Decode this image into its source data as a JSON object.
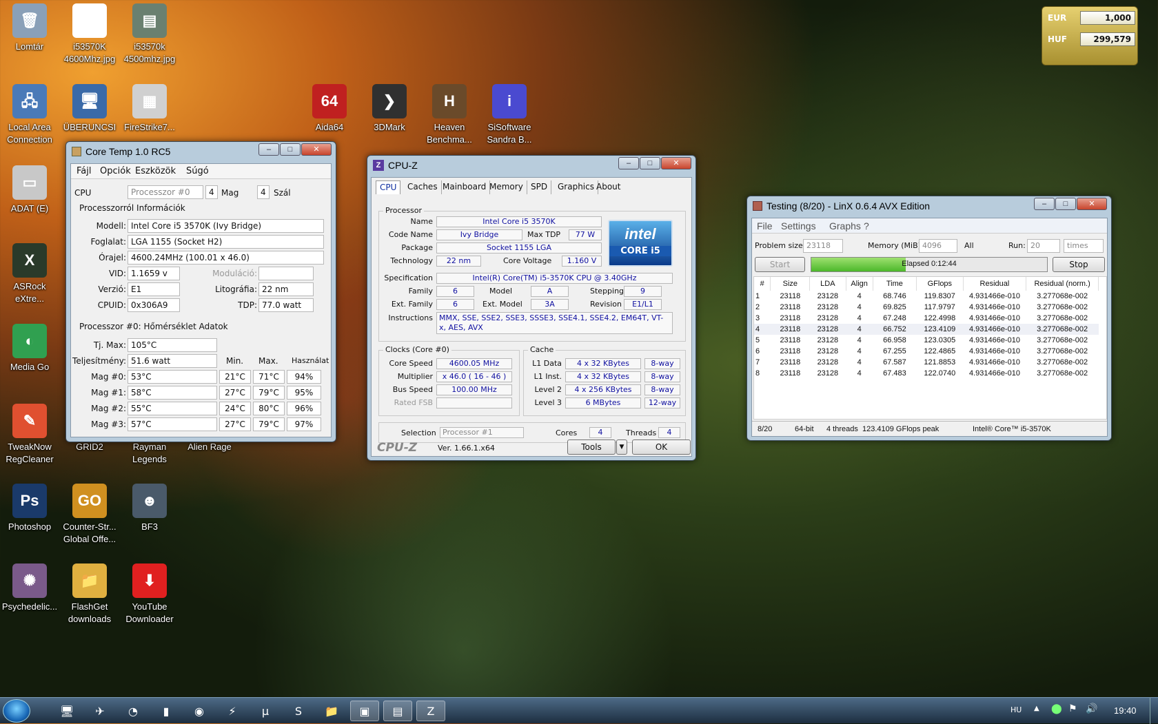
{
  "desktop": {
    "icons": [
      {
        "label": "Lomtár",
        "symbol": "🗑",
        "color": "#8aa0b8"
      },
      {
        "label": "i53570K 4600Mhz.jpg",
        "symbol": "▤",
        "color": "#ffffff"
      },
      {
        "label": "i53570k 4500mhz.jpg",
        "symbol": "▤",
        "color": "#6a8070"
      },
      {
        "label": "Local Area Connection",
        "symbol": "🖧",
        "color": "#4a7ab8"
      },
      {
        "label": "ÜBERUNCSI",
        "symbol": "🖥",
        "color": "#3a6aa8"
      },
      {
        "label": "FireStrike7...",
        "symbol": "▦",
        "color": "#d0d0d0"
      },
      {
        "label": "ADAT (E)",
        "symbol": "▭",
        "color": "#c8c8c8"
      },
      {
        "label": "ASRock eXtre...",
        "symbol": "X",
        "color": "#2a3a2a"
      },
      {
        "label": "Media Go",
        "symbol": "◐",
        "color": "#30a050"
      },
      {
        "label": "TweakNow RegCleaner",
        "symbol": "✎",
        "color": "#e05030"
      },
      {
        "label": "GRID2",
        "symbol": "",
        "color": "rgba(0,0,0,0)"
      },
      {
        "label": "Rayman Legends",
        "symbol": "",
        "color": "rgba(0,0,0,0)"
      },
      {
        "label": "Alien Rage",
        "symbol": "",
        "color": "rgba(0,0,0,0)"
      },
      {
        "label": "Photoshop",
        "symbol": "Ps",
        "color": "#1a3a6a"
      },
      {
        "label": "Counter-Str... Global Offe...",
        "symbol": "GO",
        "color": "#d09020"
      },
      {
        "label": "BF3",
        "symbol": "☻",
        "color": "#4a5a6a"
      },
      {
        "label": "Psychedelic...",
        "symbol": "✺",
        "color": "#7a5a8a"
      },
      {
        "label": "FlashGet downloads",
        "symbol": "📁",
        "color": "#e0b040"
      },
      {
        "label": "YouTube Downloader",
        "symbol": "⬇",
        "color": "#e02020"
      },
      {
        "label": "Aida64",
        "symbol": "64",
        "color": "#c02020"
      },
      {
        "label": "3DMark",
        "symbol": "❯",
        "color": "#303030"
      },
      {
        "label": "Heaven Benchma...",
        "symbol": "H",
        "color": "#6a4a2a"
      },
      {
        "label": "SiSoftware Sandra B...",
        "symbol": "i",
        "color": "#4a4ad0"
      }
    ]
  },
  "currency": {
    "eur_label": "EUR",
    "eur_value": "1,000",
    "huf_label": "HUF",
    "huf_value": "299,579"
  },
  "coretemp": {
    "title": "Core Temp 1.0 RC5",
    "menu": [
      "Fájl",
      "Opciók",
      "Eszközök",
      "Súgó"
    ],
    "cpu_label": "CPU",
    "processor_select": "Processzor #0",
    "cores": "4",
    "cores_label": "Mag",
    "threads": "4",
    "threads_label": "Szál",
    "info_title": "Processzorról Információk",
    "model_label": "Modell:",
    "model": "Intel Core i5 3570K (Ivy Bridge)",
    "socket_label": "Foglalat:",
    "socket": "LGA 1155 (Socket H2)",
    "clock_label": "Órajel:",
    "clock": "4600.24MHz (100.01 x 46.0)",
    "vid_label": "VID:",
    "vid": "1.1659 v",
    "mod_label": "Moduláció:",
    "rev_label": "Verzió:",
    "rev": "E1",
    "litho_label": "Litográfia:",
    "litho": "22 nm",
    "cpuid_label": "CPUID:",
    "cpuid": "0x306A9",
    "tdp_label": "TDP:",
    "tdp": "77.0 watt",
    "temp_title": "Processzor #0: Hőmérséklet Adatok",
    "tjmax_label": "Tj. Max:",
    "tjmax": "105°C",
    "power_label": "Teljesítmény:",
    "power": "51.6 watt",
    "col_min": "Min.",
    "col_max": "Max.",
    "col_load": "Használat",
    "cores_rows": [
      {
        "label": "Mag #0:",
        "temp": "53°C",
        "min": "21°C",
        "max": "71°C",
        "load": "94%"
      },
      {
        "label": "Mag #1:",
        "temp": "58°C",
        "min": "27°C",
        "max": "79°C",
        "load": "95%"
      },
      {
        "label": "Mag #2:",
        "temp": "55°C",
        "min": "24°C",
        "max": "80°C",
        "load": "96%"
      },
      {
        "label": "Mag #3:",
        "temp": "57°C",
        "min": "27°C",
        "max": "79°C",
        "load": "97%"
      }
    ]
  },
  "cpuz": {
    "title": "CPU-Z",
    "tabs": [
      "CPU",
      "Caches",
      "Mainboard",
      "Memory",
      "SPD",
      "Graphics",
      "About"
    ],
    "processor_group": "Processor",
    "name_label": "Name",
    "name": "Intel Core i5 3570K",
    "codename_label": "Code Name",
    "codename": "Ivy Bridge",
    "maxtdp_label": "Max TDP",
    "maxtdp": "77 W",
    "package_label": "Package",
    "package": "Socket 1155 LGA",
    "tech_label": "Technology",
    "tech": "22 nm",
    "voltage_label": "Core Voltage",
    "voltage": "1.160 V",
    "spec_label": "Specification",
    "spec": "Intel(R) Core(TM) i5-3570K CPU @ 3.40GHz",
    "family_label": "Family",
    "family": "6",
    "model_label": "Model",
    "model": "A",
    "stepping_label": "Stepping",
    "stepping": "9",
    "extfam_label": "Ext. Family",
    "extfam": "6",
    "extmodel_label": "Ext. Model",
    "extmodel": "3A",
    "revision_label": "Revision",
    "revision": "E1/L1",
    "instr_label": "Instructions",
    "instr": "MMX, SSE, SSE2, SSE3, SSSE3, SSE4.1, SSE4.2, EM64T, VT-x, AES, AVX",
    "clocks_group": "Clocks (Core #0)",
    "corespeed_label": "Core Speed",
    "corespeed": "4600.05 MHz",
    "mult_label": "Multiplier",
    "mult": "x 46.0 ( 16 - 46 )",
    "bus_label": "Bus Speed",
    "bus": "100.00 MHz",
    "fsb_label": "Rated FSB",
    "fsb": "",
    "cache_group": "Cache",
    "l1d_label": "L1 Data",
    "l1d": "4 x 32 KBytes",
    "l1d_way": "8-way",
    "l1i_label": "L1 Inst.",
    "l1i": "4 x 32 KBytes",
    "l1i_way": "8-way",
    "l2_label": "Level 2",
    "l2": "4 x 256 KBytes",
    "l2_way": "8-way",
    "l3_label": "Level 3",
    "l3": "6 MBytes",
    "l3_way": "12-way",
    "selection_label": "Selection",
    "selection": "Processor #1",
    "cores_label": "Cores",
    "cores": "4",
    "threads_label": "Threads",
    "threads": "4",
    "brand": "CPU-Z",
    "version": "Ver. 1.66.1.x64",
    "tools": "Tools",
    "ok": "OK",
    "intel_inside": "intel",
    "intel_core": "CORE i5"
  },
  "linx": {
    "title": "Testing (8/20) - LinX 0.6.4 AVX Edition",
    "menu": [
      "File",
      "Settings",
      "Graphs",
      "?"
    ],
    "problem_label": "Problem size:",
    "problem": "23118",
    "memory_label": "Memory (MiB):",
    "memory": "4096",
    "all": "All",
    "run_label": "Run:",
    "run": "20",
    "times": "times",
    "start": "Start",
    "elapsed": "Elapsed 0:12:44",
    "stop": "Stop",
    "progress": 0.4,
    "columns": [
      "#",
      "Size",
      "LDA",
      "Align",
      "Time",
      "GFlops",
      "Residual",
      "Residual (norm.)"
    ],
    "rows": [
      [
        "1",
        "23118",
        "23128",
        "4",
        "68.746",
        "119.8307",
        "4.931466e-010",
        "3.277068e-002"
      ],
      [
        "2",
        "23118",
        "23128",
        "4",
        "69.825",
        "117.9797",
        "4.931466e-010",
        "3.277068e-002"
      ],
      [
        "3",
        "23118",
        "23128",
        "4",
        "67.248",
        "122.4998",
        "4.931466e-010",
        "3.277068e-002"
      ],
      [
        "4",
        "23118",
        "23128",
        "4",
        "66.752",
        "123.4109",
        "4.931466e-010",
        "3.277068e-002"
      ],
      [
        "5",
        "23118",
        "23128",
        "4",
        "66.958",
        "123.0305",
        "4.931466e-010",
        "3.277068e-002"
      ],
      [
        "6",
        "23118",
        "23128",
        "4",
        "67.255",
        "122.4865",
        "4.931466e-010",
        "3.277068e-002"
      ],
      [
        "7",
        "23118",
        "23128",
        "4",
        "67.587",
        "121.8853",
        "4.931466e-010",
        "3.277068e-002"
      ],
      [
        "8",
        "23118",
        "23128",
        "4",
        "67.483",
        "122.0740",
        "4.931466e-010",
        "3.277068e-002"
      ]
    ],
    "status": [
      "8/20",
      "64-bit",
      "4 threads",
      "123.4109 GFlops peak",
      "Intel® Core™ i5-3570K"
    ]
  },
  "taskbar": {
    "lang": "HU",
    "clock": "19:40",
    "apps": [
      "start-orb",
      "computer-icon",
      "aida-icon",
      "avast-icon",
      "orange-icon",
      "chrome-icon",
      "winamp-icon",
      "utorrent-icon",
      "skype-icon",
      "explorer-icon",
      "coretemp-icon",
      "linx-icon",
      "cpuz-icon"
    ]
  }
}
